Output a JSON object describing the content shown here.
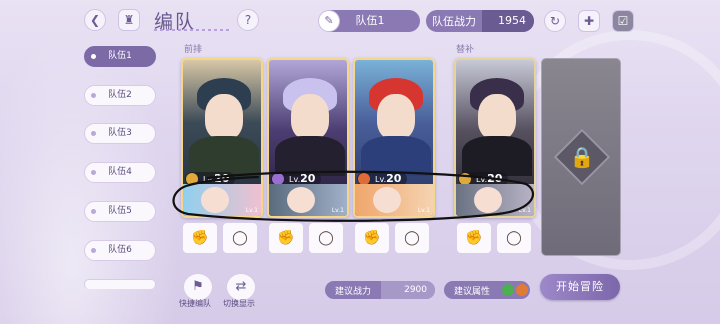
{
  "header": {
    "title": "编队",
    "team_name": "队伍1",
    "power_label": "队伍战力",
    "power_value": "1954"
  },
  "sidebar": {
    "teams": [
      {
        "label": "队伍1",
        "active": true
      },
      {
        "label": "队伍2",
        "active": false
      },
      {
        "label": "队伍3",
        "active": false
      },
      {
        "label": "队伍4",
        "active": false
      },
      {
        "label": "队伍5",
        "active": false
      },
      {
        "label": "队伍6",
        "active": false
      }
    ]
  },
  "sections": {
    "front": "前排",
    "sub": "替补"
  },
  "cards": [
    {
      "level_prefix": "Lv.",
      "level": "20",
      "support_level": "Lv.1"
    },
    {
      "level_prefix": "Lv.",
      "level": "20",
      "support_level": "Lv.1"
    },
    {
      "level_prefix": "Lv.",
      "level": "20",
      "support_level": "Lv.1"
    },
    {
      "level_prefix": "Lv.",
      "level": "20",
      "support_level": "Lv.1"
    }
  ],
  "footer": {
    "quick_label": "快捷编队",
    "switch_label": "切换显示",
    "recommended_power_label": "建议战力",
    "recommended_power_value": "2900",
    "recommended_attr_label": "建议属性",
    "start_label": "开始冒险"
  },
  "colors": {
    "accent": "#8a79b3",
    "card_border": "#f4d78a",
    "attr_green": "#4caf50",
    "attr_orange": "#e07a34"
  },
  "icons": {
    "back": "back-arrow-icon",
    "home": "castle-icon",
    "help": "question-icon",
    "edit": "pen-icon",
    "refresh": "refresh-icon",
    "add": "add-page-icon",
    "clipboard": "clipboard-icon",
    "lock": "lock-icon",
    "equip_a": "gauntlet-icon",
    "equip_b": "ring-icon"
  }
}
